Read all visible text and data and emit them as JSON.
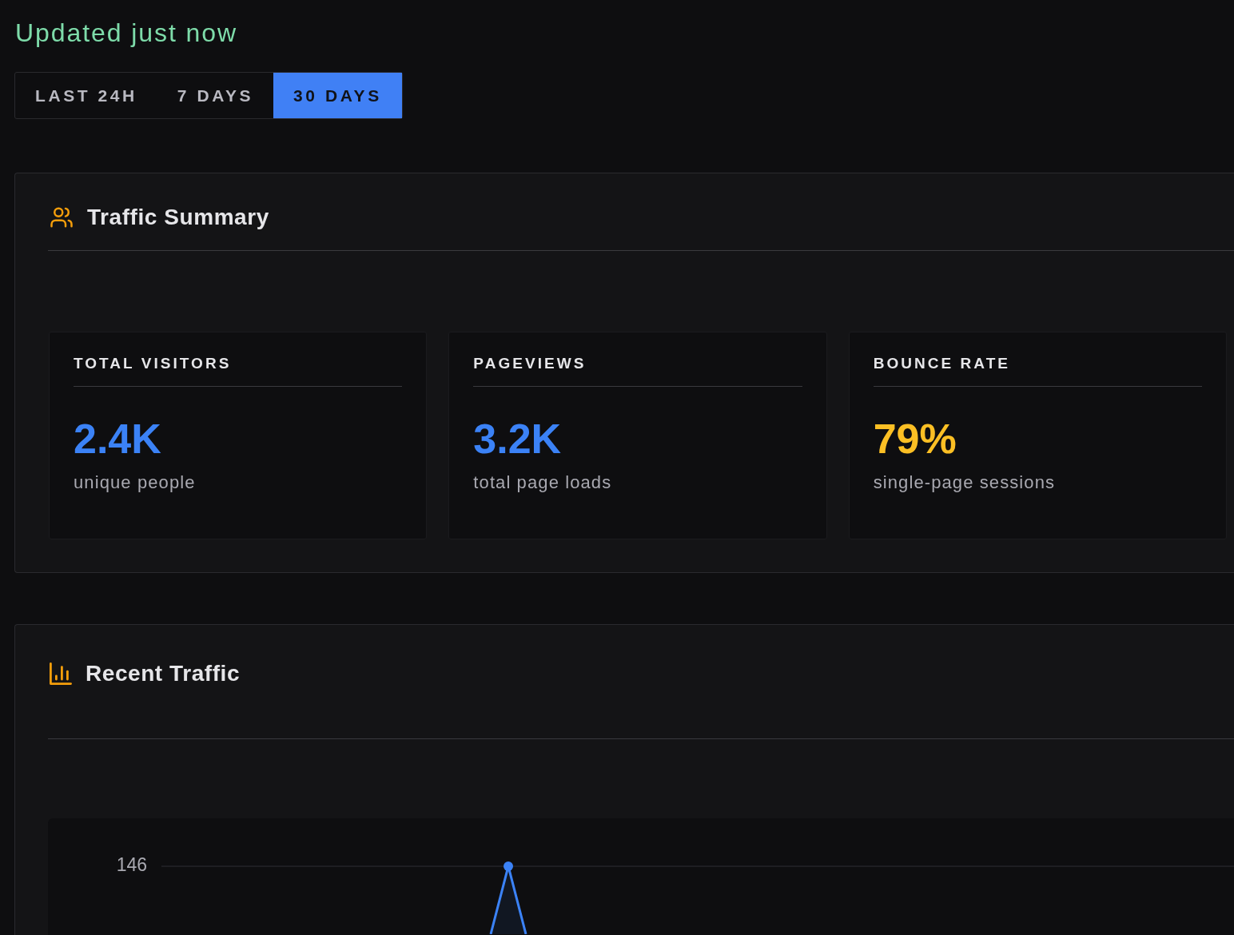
{
  "status": "Updated just now",
  "range_tabs": [
    {
      "label": "LAST 24H",
      "selected": false
    },
    {
      "label": "7 DAYS",
      "selected": false
    },
    {
      "label": "30 DAYS",
      "selected": true
    }
  ],
  "panels": [
    {
      "kind": "summary",
      "title": "Traffic Summary",
      "stats": [
        {
          "label": "TOTAL VISITORS",
          "value": "2.4K",
          "caption": "unique people",
          "color": "#3b82f6"
        },
        {
          "label": "PAGEVIEWS",
          "value": "3.2K",
          "caption": "total page loads",
          "color": "#3b82f6"
        },
        {
          "label": "BOUNCE RATE",
          "value": "79%",
          "caption": "single-page sessions",
          "color": "#fbbf24"
        }
      ]
    },
    {
      "kind": "chart",
      "title": "Recent Traffic",
      "y_tick_label": "146"
    }
  ]
}
